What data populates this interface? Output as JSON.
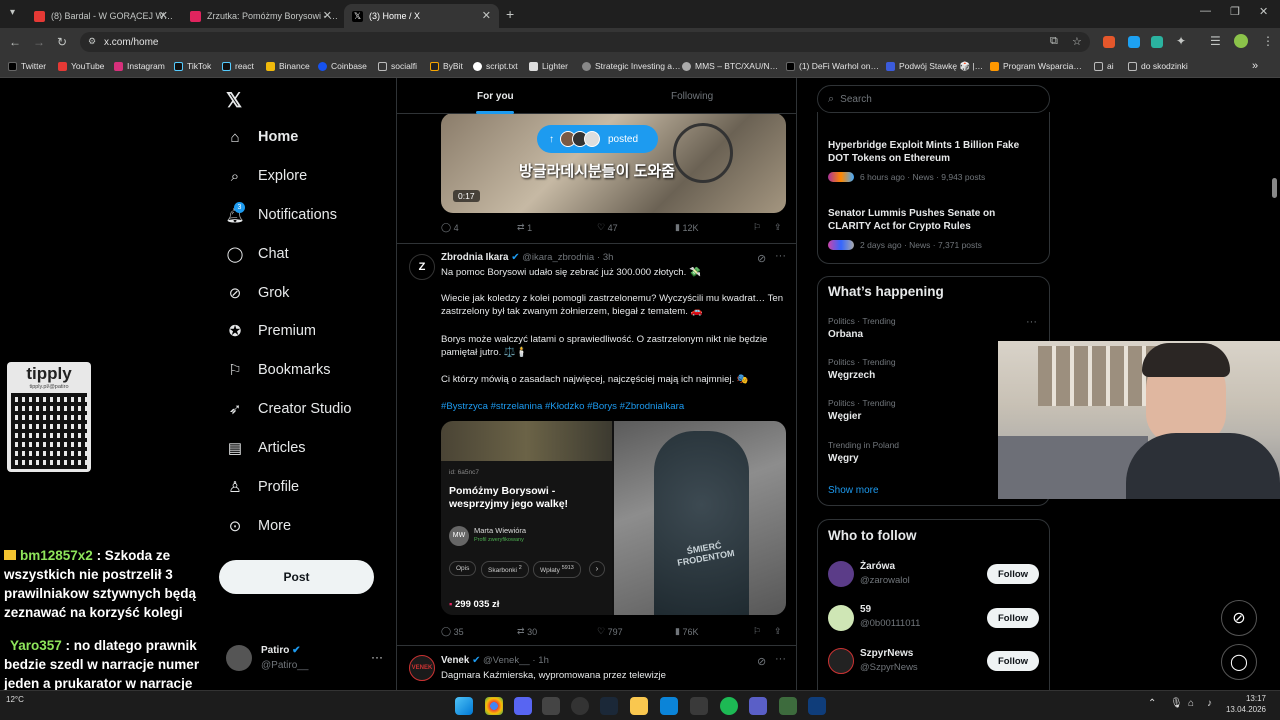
{
  "browser": {
    "tabs": [
      {
        "label": "(8) Bardal - W GORĄCEJ W…"
      },
      {
        "label": "Zrzutka: Pomóżmy Borysowi - …"
      },
      {
        "label": "(3) Home / X"
      }
    ],
    "url": "x.com/home",
    "bookmarks": [
      "Twitter",
      "YouTube",
      "Instagram",
      "TikTok",
      "react",
      "Binance",
      "Coinbase",
      "socialfi",
      "ByBit",
      "script.txt",
      "Lighter",
      "Strategic Investing a…",
      "MMS – BTC/XAU/N…",
      "(1) DeFi Warhol on…",
      "Podwój Stawkę 🎲 |…",
      "Program Wsparcia…",
      "ai",
      "do skodzinki"
    ]
  },
  "sidebar": {
    "items": [
      {
        "label": "Home"
      },
      {
        "label": "Explore"
      },
      {
        "label": "Notifications",
        "badge": "3"
      },
      {
        "label": "Chat"
      },
      {
        "label": "Grok"
      },
      {
        "label": "Premium"
      },
      {
        "label": "Bookmarks"
      },
      {
        "label": "Creator Studio"
      },
      {
        "label": "Articles"
      },
      {
        "label": "Profile"
      },
      {
        "label": "More"
      }
    ],
    "post_label": "Post",
    "account": {
      "name": "Patiro",
      "handle": "@Patiro__"
    }
  },
  "feed": {
    "tabs": [
      "For you",
      "Following"
    ],
    "posted_pill": "posted",
    "video": {
      "duration": "0:17",
      "caption": "방글라데시분들이 도와줌"
    },
    "tweet0_actions": {
      "replies": "4",
      "reposts": "1",
      "likes": "47",
      "views": "12K"
    },
    "tweet1": {
      "name": "Zbrodnia Ikara",
      "handle": "@ikara_zbrodnia",
      "time": "3h",
      "p1": "Na pomoc Borysowi udało się zebrać już 300.000 złotych. 💸",
      "p2": "Wiecie jak koledzy z kolei pomogli zastrzelonemu? Wyczyścili mu kwadrat… Ten zastrzelony był tak zwanym żołnierzem, biegał z tematem. 🚗",
      "p3": "Borys może walczyć latami o sprawiedliwość. O zastrzelonym nikt nie będzie pamiętał jutro. ⚖️🕯️",
      "p4": "Ci którzy mówią o zasadach najwięcej, najczęściej mają ich najmniej. 🎭",
      "hashtags": "#Bystrzyca #strzelanina #Kłodzko #Borys #ZbrodniaIkara",
      "card": {
        "id": "id: 6a5nc7",
        "title": "Pomóżmy Borysowi - wesprzyjmy jego walkę!",
        "author": "Marta Wiewióra",
        "verified": "Profil zweryfikowany",
        "initials": "MW",
        "tabs": [
          "Opis",
          "Skarbonki",
          "Wpłaty"
        ],
        "skarbonki_count": "2",
        "wplaty_count": "5913",
        "amount": "299 035 zł"
      },
      "tattoo_text": "ŚMIERĆ FRODENTOM",
      "actions": {
        "replies": "35",
        "reposts": "30",
        "likes": "797",
        "views": "76K"
      }
    },
    "tweet2": {
      "name": "Venek",
      "handle": "@Venek__",
      "time": "1h",
      "text": "Dagmara Kaźmierska, wypromowana przez telewizje"
    }
  },
  "right": {
    "search_placeholder": "Search",
    "news": [
      {
        "title": "Hyperbridge Exploit Mints 1 Billion Fake DOT Tokens on Ethereum",
        "meta": "6 hours ago · News · 9,943 posts"
      },
      {
        "title": "Senator Lummis Pushes Senate on CLARITY Act for Crypto Rules",
        "meta": "2 days ago · News · 7,371 posts"
      }
    ],
    "happening_title": "What’s happening",
    "trends": [
      {
        "context": "Politics · Trending",
        "name": "Orbana"
      },
      {
        "context": "Politics · Trending",
        "name": "Węgrzech"
      },
      {
        "context": "Politics · Trending",
        "name": "Węgier"
      },
      {
        "context": "Trending in Poland",
        "name": "Węgry"
      }
    ],
    "show_more": "Show more",
    "wtf_title": "Who to follow",
    "follow_label": "Follow",
    "follows": [
      {
        "name": "Żarówa",
        "handle": "@zarowalol"
      },
      {
        "name": "59",
        "handle": "@0b00111011"
      },
      {
        "name": "SzpyrNews",
        "handle": "@SzpyrNews"
      }
    ]
  },
  "overlay": {
    "tipply": "tipply",
    "tipply_url": "tipply.pl/@patiro",
    "chat": [
      {
        "user": "bm12857x2",
        "text": " : Szkoda ze wszystkich nie postrzelił 3 prawilniakow sztywnych będą zeznawać na korzyść kolegi"
      },
      {
        "user": "Yaro357",
        "text": " : no dlatego prawnik bedzie szedl w narracje numer jeden a prukarator w narracje numer dwa ;p"
      }
    ]
  },
  "taskbar": {
    "time": "13:17",
    "date": "13.04.2026",
    "temp": "12°C"
  },
  "colors": {
    "accent": "#1d9bf0",
    "bg": "#000000",
    "border": "#2f3336",
    "muted": "#71767b"
  }
}
